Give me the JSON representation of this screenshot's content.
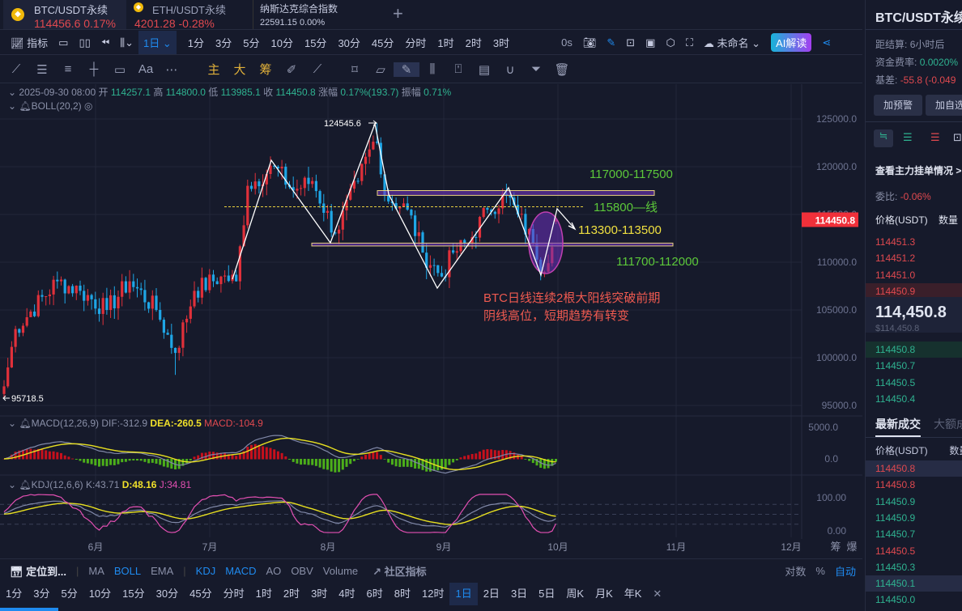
{
  "tabs": [
    {
      "title": "BTC/USDT永续",
      "price": "114456.6",
      "change": "0.17%"
    },
    {
      "title": "ETH/USDT永续",
      "price": "4201.28",
      "change": "-0.28%"
    },
    {
      "title": "纳斯达克综合指数",
      "price": "22591.15",
      "change": "0.00%"
    }
  ],
  "add_tab": "+",
  "toolbar": {
    "indicator": "指标",
    "interval": "1日",
    "intervals": [
      "1分",
      "3分",
      "5分",
      "10分",
      "15分",
      "30分",
      "45分",
      "分时",
      "1时",
      "2时",
      "3时"
    ],
    "countdown": "0s",
    "layout_name": "未命名",
    "ai": "AI解读"
  },
  "draw_tools": [
    "主",
    "大",
    "筹"
  ],
  "ohlc": {
    "date": "2025-09-30 08:00",
    "open_l": "开",
    "open": "114257.1",
    "high_l": "高",
    "high": "114800.0",
    "low_l": "低",
    "low": "113985.1",
    "close_l": "收",
    "close": "114450.8",
    "chg_l": "涨幅",
    "chg": "0.17%(193.7)",
    "amp_l": "振幅",
    "amp": "0.71%"
  },
  "boll": "BOLL(20,2)",
  "macd": {
    "name": "MACD(12,26,9)",
    "dif": "DIF:-312.9",
    "dea": "DEA:-260.5",
    "macd": "MACD:-104.9",
    "ticks": [
      "5000.0",
      "0.0"
    ]
  },
  "kdj": {
    "name": "KDJ(12,6,6)",
    "k": "K:43.71",
    "d": "D:48.16",
    "j": "J:34.81",
    "ticks": [
      "100.00",
      "0.00"
    ]
  },
  "price_axis": [
    "125000.0",
    "120000.0",
    "115000.0",
    "110000.0",
    "105000.0",
    "100000.0",
    "95000.0"
  ],
  "last_price_tag": "114450.8",
  "months": [
    "6月",
    "7月",
    "8月",
    "9月",
    "10月",
    "11月",
    "12月"
  ],
  "axis_extra": [
    "筹",
    "爆"
  ],
  "annotations": {
    "high": "124545.6",
    "low": "95718.5",
    "zone1": "117000-117500",
    "line": "115800—线",
    "target": "113300-113500",
    "zone2": "111700-112000",
    "note1": "BTC日线连续2根大阳线突破前期",
    "note2": "阴线高位，短期趋势有转变"
  },
  "colors": {
    "up": "#e0303a",
    "down": "#1fa6e6",
    "macd_up": "#c8101c",
    "macd_down": "#4caf1a",
    "accent": "#1f8bf0"
  },
  "chart_data": {
    "type": "candlestick",
    "anchors": [
      [
        0,
        97000
      ],
      [
        3,
        103000
      ],
      [
        14,
        108000
      ],
      [
        20,
        107000
      ],
      [
        27,
        105000
      ],
      [
        33,
        108000
      ],
      [
        40,
        105000
      ],
      [
        45,
        100500
      ],
      [
        50,
        107000
      ],
      [
        57,
        108500
      ],
      [
        61,
        108000
      ],
      [
        64,
        118000
      ],
      [
        71,
        120000
      ],
      [
        76,
        117500
      ],
      [
        81,
        118500
      ],
      [
        87,
        113000
      ],
      [
        93,
        118500
      ],
      [
        98,
        123500
      ],
      [
        100,
        117000
      ],
      [
        106,
        115500
      ],
      [
        110,
        111000
      ],
      [
        115,
        108500
      ],
      [
        118,
        111000
      ],
      [
        122,
        112000
      ],
      [
        127,
        115500
      ],
      [
        132,
        117000
      ],
      [
        135,
        115000
      ],
      [
        139,
        112000
      ],
      [
        142,
        109000
      ],
      [
        145,
        114450
      ]
    ],
    "ylim": [
      95000,
      125000
    ]
  },
  "bottom": {
    "locate": "定位到...",
    "main": [
      "MA",
      "BOLL",
      "EMA"
    ],
    "sub": [
      "KDJ",
      "MACD",
      "AO",
      "OBV",
      "Volume"
    ],
    "community": "社区指标",
    "right": [
      "对数",
      "%",
      "自动"
    ]
  },
  "timeframes": [
    "1分",
    "3分",
    "5分",
    "10分",
    "15分",
    "30分",
    "45分",
    "分时",
    "1时",
    "2时",
    "3时",
    "4时",
    "6时",
    "8时",
    "12时",
    "1日",
    "2日",
    "3日",
    "5日",
    "周K",
    "月K",
    "年K"
  ],
  "panel": {
    "title": "BTC/USDT永续",
    "settle_l": "距结算:",
    "settle": "6小时后",
    "fund_l": "资金费率:",
    "fund": "0.0020%",
    "basis_l": "基差:",
    "basis": "-55.8 (-0.049",
    "alert": "加预警",
    "fav": "加自选",
    "depth_link": "查看主力挂单情况 >",
    "ratio_l": "委比:",
    "ratio": "-0.06%",
    "price_h": "价格(USDT)",
    "qty_h": "数量",
    "asks": [
      "114451.3",
      "114451.2",
      "114451.0",
      "114450.9"
    ],
    "last": "114,450.8",
    "last_usd": "$114,450.8",
    "bids": [
      "114450.8",
      "114450.7",
      "114450.5",
      "114450.4"
    ],
    "trades_tab": "最新成交",
    "big_tab": "大额成",
    "trades": [
      [
        "114450.8",
        "r"
      ],
      [
        "114450.8",
        "r"
      ],
      [
        "114450.9",
        "g"
      ],
      [
        "114450.9",
        "g"
      ],
      [
        "114450.7",
        "g"
      ],
      [
        "114450.5",
        "r"
      ],
      [
        "114450.3",
        "g"
      ],
      [
        "114450.1",
        "g"
      ],
      [
        "114450.0",
        "g"
      ]
    ]
  }
}
